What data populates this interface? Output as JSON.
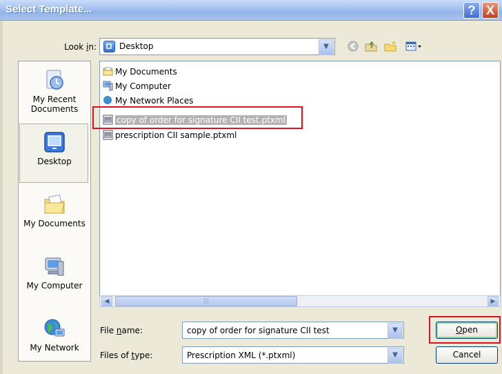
{
  "window": {
    "title": "Select Template..."
  },
  "titlebar_buttons": {
    "help": "?",
    "close": "X"
  },
  "lookin": {
    "label_pre": "Look ",
    "label_u": "i",
    "label_post": "n:",
    "value": "Desktop"
  },
  "toolbar": {
    "back_icon": "back-icon",
    "up_icon": "up-folder-icon",
    "new_folder_icon": "new-folder-icon",
    "views_icon": "views-menu-icon"
  },
  "places": [
    {
      "label_line1": "My Recent",
      "label_line2": "Documents",
      "icon": "recent-documents-icon"
    },
    {
      "label_line1": "Desktop",
      "label_line2": "",
      "icon": "desktop-icon"
    },
    {
      "label_line1": "My Documents",
      "label_line2": "",
      "icon": "my-documents-icon"
    },
    {
      "label_line1": "My Computer",
      "label_line2": "",
      "icon": "my-computer-icon"
    },
    {
      "label_line1": "My Network",
      "label_line2": "",
      "icon": "my-network-icon"
    }
  ],
  "files": [
    {
      "name": "My Documents",
      "icon": "folder-icon"
    },
    {
      "name": "My Computer",
      "icon": "computer-icon"
    },
    {
      "name": "My Network Places",
      "icon": "network-icon"
    },
    {
      "name": "copy of order for signature CII test.ptxml",
      "icon": "ptxml-file-icon",
      "selected": true
    },
    {
      "name": "prescription CII sample.ptxml",
      "icon": "ptxml-file-icon"
    }
  ],
  "filename": {
    "label_pre": "File ",
    "label_u": "n",
    "label_post": "ame:",
    "value": "copy of order for signature CII test"
  },
  "filetype": {
    "label_pre": "Files of ",
    "label_u": "t",
    "label_post": "ype:",
    "value": "Prescription XML (*.ptxml)"
  },
  "buttons": {
    "open_u": "O",
    "open_rest": "pen",
    "cancel": "Cancel"
  },
  "colors": {
    "highlight": "#e01020",
    "title_text": "#ffffff",
    "dialog_bg": "#ece9d8"
  }
}
